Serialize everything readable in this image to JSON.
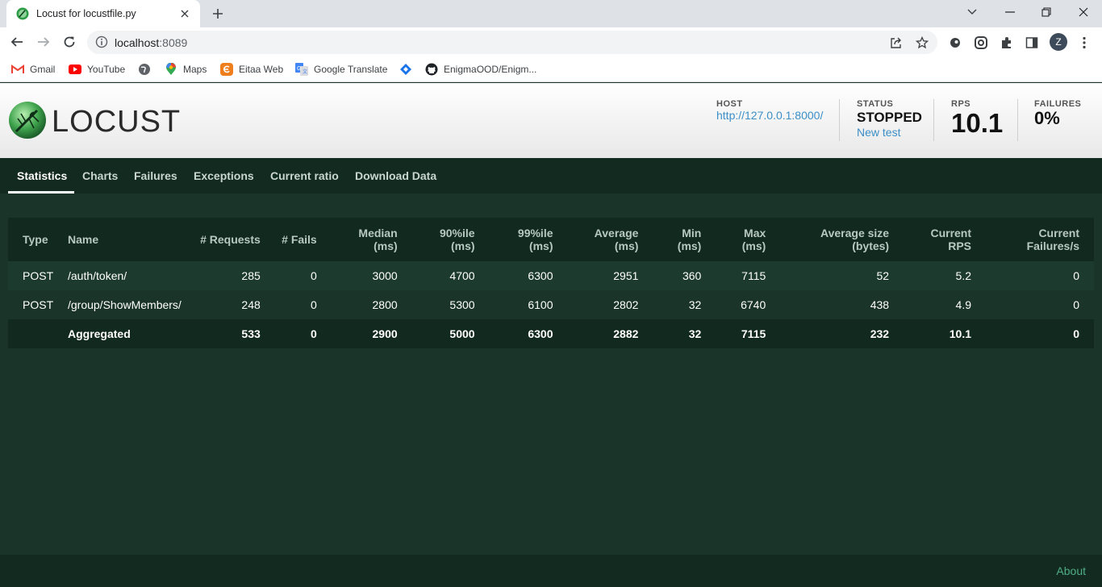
{
  "browser": {
    "tab_title": "Locust for locustfile.py",
    "url_host": "localhost",
    "url_port": ":8089",
    "avatar_letter": "Z",
    "bookmarks": [
      {
        "label": "Gmail",
        "icon": "gmail-icon"
      },
      {
        "label": "YouTube",
        "icon": "youtube-icon"
      },
      {
        "label": "",
        "icon": "globe-icon"
      },
      {
        "label": "Maps",
        "icon": "maps-icon"
      },
      {
        "label": "Eitaa Web",
        "icon": "eitaa-icon"
      },
      {
        "label": "Google Translate",
        "icon": "translate-icon"
      },
      {
        "label": "",
        "icon": "diamond-icon"
      },
      {
        "label": "EnigmaOOD/Enigm...",
        "icon": "github-icon"
      }
    ]
  },
  "header": {
    "logo_text": "LOCUST",
    "host_label": "HOST",
    "host_value": "http://127.0.0.1:8000/",
    "status_label": "STATUS",
    "status_value": "STOPPED",
    "new_test": "New test",
    "rps_label": "RPS",
    "rps_value": "10.1",
    "failures_label": "FAILURES",
    "failures_value": "0%"
  },
  "nav": {
    "tabs": [
      "Statistics",
      "Charts",
      "Failures",
      "Exceptions",
      "Current ratio",
      "Download Data"
    ]
  },
  "table": {
    "headers": [
      [
        "Type"
      ],
      [
        "Name"
      ],
      [
        "# Requests"
      ],
      [
        "# Fails"
      ],
      [
        "Median",
        "(ms)"
      ],
      [
        "90%ile",
        "(ms)"
      ],
      [
        "99%ile",
        "(ms)"
      ],
      [
        "Average",
        "(ms)"
      ],
      [
        "Min",
        "(ms)"
      ],
      [
        "Max",
        "(ms)"
      ],
      [
        "Average size",
        "(bytes)"
      ],
      [
        "Current",
        "RPS"
      ],
      [
        "Current",
        "Failures/s"
      ]
    ],
    "rows": [
      [
        "POST",
        "/auth/token/",
        "285",
        "0",
        "3000",
        "4700",
        "6300",
        "2951",
        "360",
        "7115",
        "52",
        "5.2",
        "0"
      ],
      [
        "POST",
        "/group/ShowMembers/",
        "248",
        "0",
        "2800",
        "5300",
        "6100",
        "2802",
        "32",
        "6740",
        "438",
        "4.9",
        "0"
      ]
    ],
    "aggregated": [
      "",
      "Aggregated",
      "533",
      "0",
      "2900",
      "5000",
      "6300",
      "2882",
      "32",
      "7115",
      "232",
      "10.1",
      "0"
    ]
  },
  "footer": {
    "about": "About"
  },
  "colors": {
    "page_bg": "#1b3429",
    "nav_bg": "#132a20",
    "link": "#3c8ec7",
    "about": "#4fae88"
  }
}
